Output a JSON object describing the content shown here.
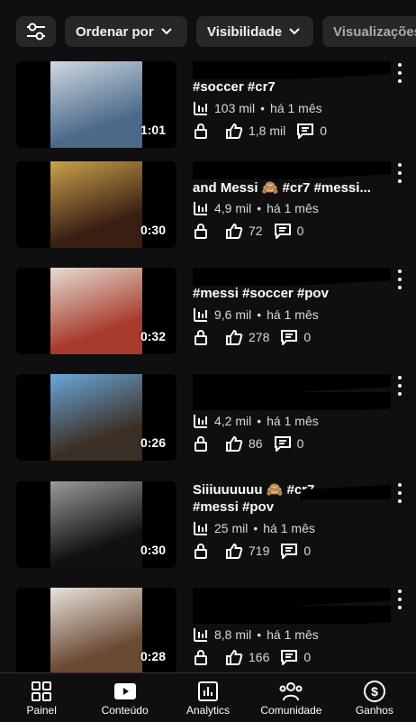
{
  "filters": {
    "sort_label": "Ordenar por",
    "visibility_label": "Visibilidade",
    "views_label": "Visualizações"
  },
  "videos": [
    {
      "title_top": "",
      "title_bottom": "#soccer #cr7",
      "views": "103 mil",
      "age": "há 1 mês",
      "likes": "1,8 mil",
      "comments": "0",
      "duration": "1:01",
      "thumb_colors": [
        "#4b6a8a",
        "#cfd8e2"
      ]
    },
    {
      "title_top": "",
      "title_bottom": "and Messi 🙈 #cr7 #messi...",
      "views": "4,9 mil",
      "age": "há 1 mês",
      "likes": "72",
      "comments": "0",
      "duration": "0:30",
      "thumb_colors": [
        "#3a1e14",
        "#c9a24a"
      ]
    },
    {
      "title_top": "",
      "title_bottom": "#messi #soccer #pov",
      "views": "9,6 mil",
      "age": "há 1 mês",
      "likes": "278",
      "comments": "0",
      "duration": "0:32",
      "thumb_colors": [
        "#a83a2c",
        "#e5ddd2"
      ]
    },
    {
      "title_top": "",
      "title_bottom": "",
      "views": "4,2 mil",
      "age": "há 1 mês",
      "likes": "86",
      "comments": "0",
      "duration": "0:26",
      "thumb_colors": [
        "#3b2e24",
        "#6aa7d9"
      ]
    },
    {
      "title_top": "Siiiuuuuuu 🙈 #cr7",
      "title_bottom": "#messi #pov",
      "views": "25 mil",
      "age": "há 1 mês",
      "likes": "719",
      "comments": "0",
      "duration": "0:30",
      "thumb_colors": [
        "#111111",
        "#9a9a9a"
      ]
    },
    {
      "title_top": "",
      "title_bottom": "",
      "views": "8,8 mil",
      "age": "há 1 mês",
      "likes": "166",
      "comments": "0",
      "duration": "0:28",
      "thumb_colors": [
        "#6b4a33",
        "#e8e3dc"
      ]
    }
  ],
  "nav": {
    "painel": "Painel",
    "conteudo": "Conteúdo",
    "analytics": "Analytics",
    "comunidade": "Comunidade",
    "ganhos": "Ganhos"
  }
}
